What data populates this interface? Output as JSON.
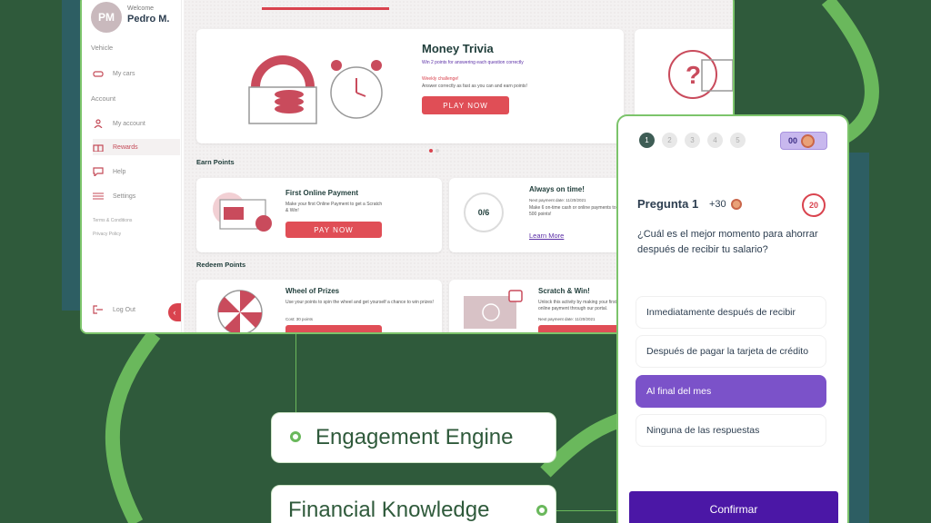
{
  "sidebar": {
    "avatar_initials": "PM",
    "welcome": "Welcome",
    "user_name": "Pedro M.",
    "vehicle_section": "Vehicle",
    "account_section": "Account",
    "items": [
      {
        "label": "My cars",
        "icon": "car-icon"
      },
      {
        "label": "My account",
        "icon": "user-icon"
      },
      {
        "label": "Rewards",
        "icon": "gift-icon"
      },
      {
        "label": "Help",
        "icon": "chat-icon"
      },
      {
        "label": "Settings",
        "icon": "sliders-icon"
      }
    ],
    "terms": "Terms & Conditions",
    "privacy": "Privacy Policy",
    "logout": "Log Out",
    "collapse_glyph": "‹"
  },
  "trivia": {
    "title": "Money Trivia",
    "subtitle": "Win 2 points for answering each question correctly",
    "weekly": "Weekly challenge!",
    "weekly_desc": "Answer correctly as fast as you can and earn points!",
    "button": "PLAY NOW"
  },
  "earn": {
    "label": "Earn Points",
    "first_payment": {
      "title": "First Online Payment",
      "desc": "Make your first Online Payment to get a Scratch & Win!",
      "button": "PAY NOW"
    },
    "on_time": {
      "title": "Always on time!",
      "next_payment": "Next payment date: 11/20/2021",
      "desc": "Make 6 on-time cash or online payments to earn 500 points!",
      "progress": "0/6",
      "progress_value": 0,
      "link": "Learn More"
    }
  },
  "redeem": {
    "label": "Redeem Points",
    "wheel": {
      "title": "Wheel of Prizes",
      "desc": "Use your points to spin the wheel and get yourself a chance to win prizes!",
      "cost": "Cost: 30 points"
    },
    "scratch": {
      "title": "Scratch & Win!",
      "desc": "Unlock this activity by making your first online payment through our portal.",
      "next_payment": "Next payment date: 11/20/2021"
    }
  },
  "quiz": {
    "steps": [
      "1",
      "2",
      "3",
      "4",
      "5"
    ],
    "current_step": 1,
    "coins": "00",
    "question_label": "Pregunta 1",
    "points": "+30",
    "timer": "20",
    "question": "¿Cuál es el mejor momento para ahorrar después de recibir tu salario?",
    "options": [
      "Inmediatamente después de recibir",
      "Después de pagar la tarjeta de crédito",
      "Al final del mes",
      "Ninguna de las respuestas"
    ],
    "selected_index": 2,
    "confirm": "Confirmar"
  },
  "labels": {
    "engagement": "Engagement Engine",
    "financial": "Financial Knowledge"
  },
  "colors": {
    "accent_red": "#e04e56",
    "purple_selected": "#7b52c9",
    "confirm_purple": "#4b17a6",
    "background_green": "#2f5a3b",
    "line_green": "#6ab85c"
  }
}
